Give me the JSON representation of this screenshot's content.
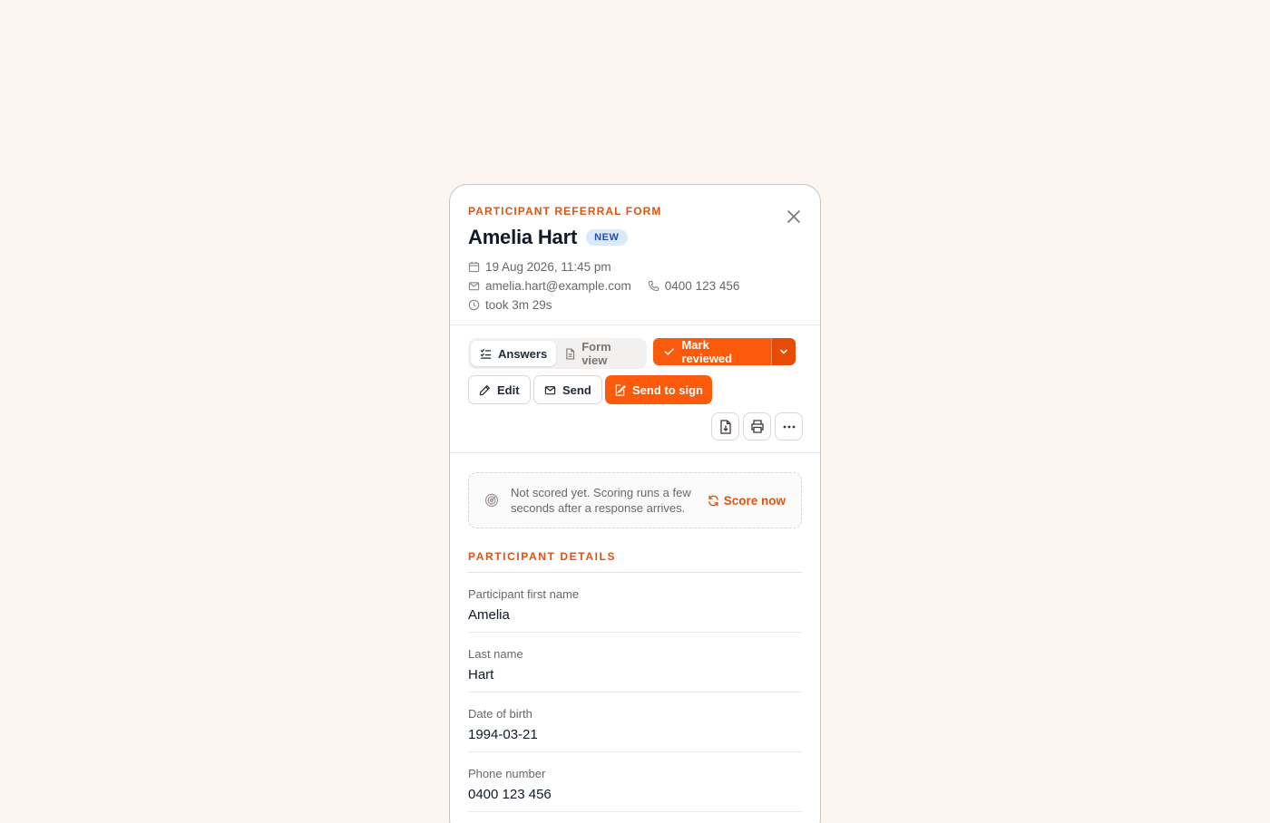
{
  "form": {
    "eyebrow": "PARTICIPANT REFERRAL FORM",
    "name": "Amelia Hart",
    "badge": "NEW",
    "date": "19 Aug 2026, 11:45 pm",
    "email": "amelia.hart@example.com",
    "phone": "0400 123 456",
    "duration": "took 3m 29s"
  },
  "tabs": [
    {
      "label": "Answers",
      "icon": "checklist-icon",
      "active": true
    },
    {
      "label": "Form view",
      "icon": "document-icon",
      "active": false
    }
  ],
  "toolbar": {
    "mark_reviewed": "Mark reviewed",
    "edit": "Edit",
    "send": "Send",
    "send_to_sign": "Send to sign",
    "icons": [
      "download-icon",
      "print-icon",
      "more-icon"
    ]
  },
  "colors": {
    "accent": "#fb5a0b",
    "accent_text": "#e2530f",
    "badge_bg": "#dbe9fd",
    "badge_text": "#1d4fb8",
    "background": "#fdf5f1"
  },
  "notice": {
    "text": "Not scored yet. Scoring runs a few seconds after a response arrives.",
    "action": "Score now"
  },
  "section": {
    "title": "PARTICIPANT DETAILS",
    "fields": [
      {
        "label": "Participant first name",
        "value": "Amelia"
      },
      {
        "label": "Last name",
        "value": "Hart"
      },
      {
        "label": "Date of birth",
        "value": "1994-03-21"
      },
      {
        "label": "Phone number",
        "value": "0400 123 456"
      }
    ]
  }
}
